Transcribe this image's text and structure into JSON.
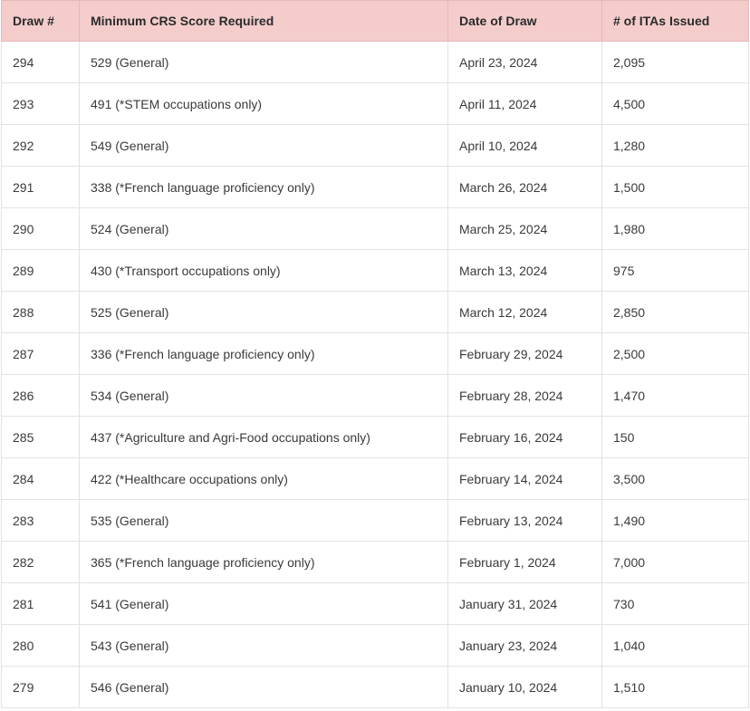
{
  "table": {
    "headers": [
      "Draw #",
      "Minimum CRS Score Required",
      "Date of Draw",
      "# of ITAs Issued"
    ],
    "rows": [
      [
        "294",
        "529 (General)",
        "April 23, 2024",
        "2,095"
      ],
      [
        "293",
        "491 (*STEM occupations only)",
        "April 11, 2024",
        "4,500"
      ],
      [
        "292",
        "549 (General)",
        "April 10, 2024",
        "1,280"
      ],
      [
        "291",
        "338 (*French language proficiency only)",
        "March 26, 2024",
        "1,500"
      ],
      [
        "290",
        "524 (General)",
        "March 25, 2024",
        "1,980"
      ],
      [
        "289",
        "430 (*Transport occupations only)",
        "March 13, 2024",
        "975"
      ],
      [
        "288",
        "525 (General)",
        "March 12, 2024",
        "2,850"
      ],
      [
        "287",
        "336 (*French language proficiency only)",
        "February 29, 2024",
        "2,500"
      ],
      [
        "286",
        "534 (General)",
        "February 28, 2024",
        "1,470"
      ],
      [
        "285",
        "437 (*Agriculture and Agri-Food occupations only)",
        "February 16, 2024",
        "150"
      ],
      [
        "284",
        "422 (*Healthcare occupations only)",
        "February 14, 2024",
        "3,500"
      ],
      [
        "283",
        "535 (General)",
        "February 13, 2024",
        "1,490"
      ],
      [
        "282",
        "365 (*French language proficiency only)",
        "February 1, 2024",
        "7,000"
      ],
      [
        "281",
        "541 (General)",
        "January 31, 2024",
        "730"
      ],
      [
        "280",
        "543 (General)",
        "January 23, 2024",
        "1,040"
      ],
      [
        "279",
        "546 (General)",
        "January 10, 2024",
        "1,510"
      ]
    ]
  },
  "colors": {
    "header_bg": "#f4cccc",
    "border": "#e2e2e2",
    "text": "#333333"
  }
}
